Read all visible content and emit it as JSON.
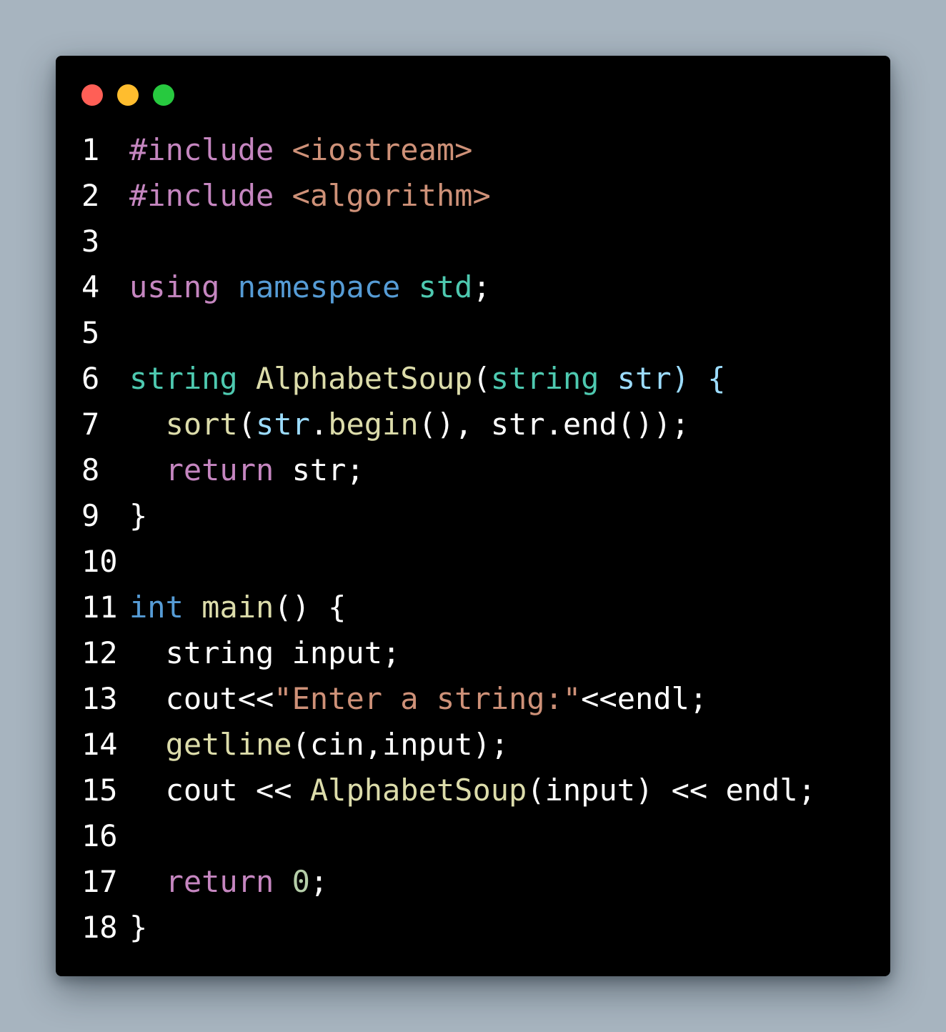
{
  "window": {
    "traffic_lights": [
      {
        "name": "close",
        "color": "#ff5f56"
      },
      {
        "name": "minimize",
        "color": "#ffbd2e"
      },
      {
        "name": "maximize",
        "color": "#27c93f"
      }
    ]
  },
  "colors": {
    "background": "#a7b4bf",
    "editor": "#000000",
    "keyword": "#c586c0",
    "string": "#ce9178",
    "namespace": "#569cd6",
    "type": "#4ec9b0",
    "function": "#dcdcaa",
    "param": "#9cdcfe",
    "number": "#b5cea8",
    "plain": "#ffffff"
  },
  "code": {
    "language": "cpp",
    "lines": [
      {
        "n": "1",
        "tokens": [
          {
            "t": "#include",
            "c": "keyword"
          },
          {
            "t": " ",
            "c": "plain"
          },
          {
            "t": "<iostream>",
            "c": "string"
          }
        ]
      },
      {
        "n": "2",
        "tokens": [
          {
            "t": "#include",
            "c": "keyword"
          },
          {
            "t": " ",
            "c": "plain"
          },
          {
            "t": "<algorithm>",
            "c": "string"
          }
        ]
      },
      {
        "n": "3",
        "tokens": []
      },
      {
        "n": "4",
        "tokens": [
          {
            "t": "using",
            "c": "keyword"
          },
          {
            "t": " ",
            "c": "plain"
          },
          {
            "t": "namespace",
            "c": "namespace"
          },
          {
            "t": " ",
            "c": "plain"
          },
          {
            "t": "std",
            "c": "type"
          },
          {
            "t": ";",
            "c": "plain"
          }
        ]
      },
      {
        "n": "5",
        "tokens": []
      },
      {
        "n": "6",
        "tokens": [
          {
            "t": "string",
            "c": "type"
          },
          {
            "t": " ",
            "c": "plain"
          },
          {
            "t": "AlphabetSoup",
            "c": "function"
          },
          {
            "t": "(",
            "c": "plain"
          },
          {
            "t": "string",
            "c": "type"
          },
          {
            "t": " ",
            "c": "plain"
          },
          {
            "t": "str",
            "c": "param"
          },
          {
            "t": ")",
            "c": "param"
          },
          {
            "t": " ",
            "c": "plain"
          },
          {
            "t": "{",
            "c": "param"
          }
        ]
      },
      {
        "n": "7",
        "tokens": [
          {
            "t": "  ",
            "c": "plain"
          },
          {
            "t": "sort",
            "c": "function"
          },
          {
            "t": "(",
            "c": "plain"
          },
          {
            "t": "str",
            "c": "param"
          },
          {
            "t": ".",
            "c": "plain"
          },
          {
            "t": "begin",
            "c": "function"
          },
          {
            "t": "(), str.end());",
            "c": "plain"
          }
        ]
      },
      {
        "n": "8",
        "tokens": [
          {
            "t": "  ",
            "c": "plain"
          },
          {
            "t": "return",
            "c": "keyword"
          },
          {
            "t": " str;",
            "c": "plain"
          }
        ]
      },
      {
        "n": "9",
        "tokens": [
          {
            "t": "}",
            "c": "plain"
          }
        ]
      },
      {
        "n": "10",
        "tokens": []
      },
      {
        "n": "11",
        "tokens": [
          {
            "t": "int",
            "c": "namespace"
          },
          {
            "t": " ",
            "c": "plain"
          },
          {
            "t": "main",
            "c": "function"
          },
          {
            "t": "() {",
            "c": "plain"
          }
        ]
      },
      {
        "n": "12",
        "tokens": [
          {
            "t": "  string input;",
            "c": "plain"
          }
        ]
      },
      {
        "n": "13",
        "tokens": [
          {
            "t": "  cout<<",
            "c": "plain"
          },
          {
            "t": "\"Enter a string:\"",
            "c": "string"
          },
          {
            "t": "<<endl;",
            "c": "plain"
          }
        ]
      },
      {
        "n": "14",
        "tokens": [
          {
            "t": "  ",
            "c": "plain"
          },
          {
            "t": "getline",
            "c": "function"
          },
          {
            "t": "(cin,input);",
            "c": "plain"
          }
        ]
      },
      {
        "n": "15",
        "tokens": [
          {
            "t": "  cout << ",
            "c": "plain"
          },
          {
            "t": "AlphabetSoup",
            "c": "function"
          },
          {
            "t": "(input) << endl;",
            "c": "plain"
          }
        ]
      },
      {
        "n": "16",
        "tokens": []
      },
      {
        "n": "17",
        "tokens": [
          {
            "t": "  ",
            "c": "plain"
          },
          {
            "t": "return",
            "c": "keyword"
          },
          {
            "t": " ",
            "c": "plain"
          },
          {
            "t": "0",
            "c": "number"
          },
          {
            "t": ";",
            "c": "plain"
          }
        ]
      },
      {
        "n": "18",
        "tokens": [
          {
            "t": "}",
            "c": "plain"
          }
        ]
      }
    ]
  }
}
